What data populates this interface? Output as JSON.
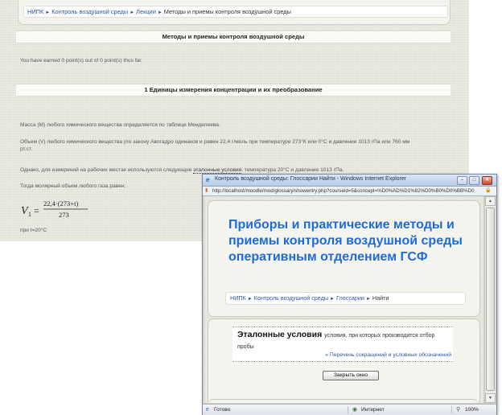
{
  "background_page": {
    "breadcrumb": [
      "НИПК",
      "Контроль воздушной среды",
      "Лекции"
    ],
    "breadcrumb_current": "Методы и приемы контроля воздушной среды",
    "page_heading": "Методы и приемы контроля воздушной среды",
    "points_text": "You have earned 0 point(s) out of 0 point(s) thus far.",
    "section_heading": "1 Единицы измерения концентрации и их преобразование",
    "para1": "Масса (М) любого химического вещества определяется по таблице Менделеева.",
    "para2_line1": "Объем (V) любого химического вещества (по закону Авогадро одинаков и равен 22,4 г/моль при температуре 273°К или 0°С и давлении 1013 гПа или 760 мм",
    "para2_line2": "рт.ст.",
    "para3_prefix": "Однако, для измерений на рабочих местах используются следующие",
    "para3_link": "эталонные условия",
    "para3_suffix": ": температура 20°С и давление 1013 гПа.",
    "para4": "Тогда молярный объем любого газа равен:",
    "formula_lhs": "V",
    "formula_sub": "1",
    "formula_eq": "=",
    "formula_num": "22,4·(273+t)",
    "formula_den": "273",
    "para5": "при t=20°С"
  },
  "popup": {
    "title": "Контроль воздушной среды: Глоссарии Найти - Windows Internet Explorer",
    "address": "http://localhost/moodle/mod/glossary/showentry.php?courseid=5&concept=%D0%AD%D1%82%D0%B0%D0%BB%D0",
    "site_title": "Приборы и практические методы и приемы контроля воздушной среды оперативным отделением ГСФ",
    "breadcrumb": [
      "НИПК",
      "Контроль воздушной среды",
      "Глоссарии"
    ],
    "breadcrumb_current": "Найти",
    "entry_term": "Эталонные условия",
    "entry_definition": "условия, при которых производится отбор пробы",
    "entry_link": "» Перечень сокращений и условных обозначений",
    "close_button": "Закрыть окно",
    "status": "Готово",
    "zone": "Интернет",
    "zoom": "100%"
  },
  "breadcrumb_separator": "►",
  "icons": {
    "ie_logo": "e",
    "minimize": "–",
    "maximize": "□",
    "close": "✕",
    "address": "▮",
    "lock": "🔒",
    "status_icon": "e",
    "zone_icon": "◉",
    "zoom_icon": "⚲",
    "scroll_up": "▲",
    "scroll_down": "▼"
  },
  "colors": {
    "link": "#2a55a5",
    "site_title": "#1f6bd6",
    "titlebar": "#b8cde8"
  }
}
